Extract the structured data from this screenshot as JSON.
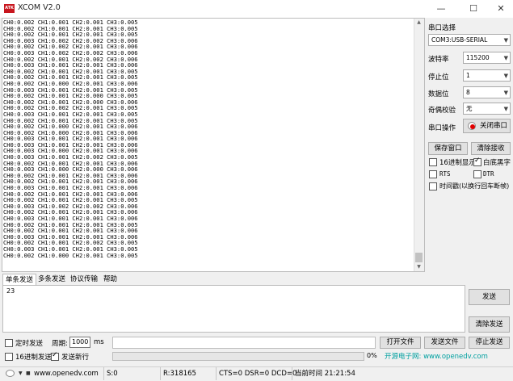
{
  "window": {
    "logo_text": "ATK",
    "title": "XCOM V2.0",
    "minimize": "—",
    "maximize": "☐",
    "close": "✕"
  },
  "receive": {
    "lines": [
      "CH0:0.002 CH1:0.001 CH2:0.001 CH3:0.005",
      "CH0:0.002 CH1:0.001 CH2:0.001 CH3:0.005",
      "CH0:0.002 CH1:0.001 CH2:0.001 CH3:0.005",
      "CH0:0.003 CH1:0.002 CH2:0.002 CH3:0.006",
      "CH0:0.002 CH1:0.002 CH2:0.001 CH3:0.006",
      "CH0:0.003 CH1:0.002 CH2:0.002 CH3:0.006",
      "CH0:0.002 CH1:0.001 CH2:0.002 CH3:0.006",
      "CH0:0.003 CH1:0.001 CH2:0.001 CH3:0.006",
      "CH0:0.002 CH1:0.001 CH2:0.001 CH3:0.005",
      "CH0:0.002 CH1:0.001 CH2:0.001 CH3:0.005",
      "CH0:0.002 CH1:0.000 CH2:0.001 CH3:0.006",
      "CH0:0.003 CH1:0.001 CH2:0.001 CH3:0.005",
      "CH0:0.002 CH1:0.001 CH2:0.000 CH3:0.005",
      "CH0:0.002 CH1:0.001 CH2:0.000 CH3:0.006",
      "CH0:0.002 CH1:0.002 CH2:0.001 CH3:0.005",
      "CH0:0.003 CH1:0.001 CH2:0.001 CH3:0.005",
      "CH0:0.002 CH1:0.001 CH2:0.001 CH3:0.005",
      "CH0:0.002 CH1:0.000 CH2:0.001 CH3:0.006",
      "CH0:0.002 CH1:0.000 CH2:0.001 CH3:0.006",
      "CH0:0.003 CH1:0.001 CH2:0.001 CH3:0.006",
      "CH0:0.003 CH1:0.001 CH2:0.001 CH3:0.006",
      "CH0:0.003 CH1:0.000 CH2:0.001 CH3:0.006",
      "CH0:0.003 CH1:0.001 CH2:0.002 CH3:0.005",
      "CH0:0.002 CH1:0.001 CH2:0.001 CH3:0.006",
      "CH0:0.003 CH1:0.000 CH2:0.000 CH3:0.006",
      "CH0:0.002 CH1:0.001 CH2:0.001 CH3:0.006",
      "CH0:0.002 CH1:0.001 CH2:0.001 CH3:0.006",
      "CH0:0.003 CH1:0.001 CH2:0.001 CH3:0.006",
      "CH0:0.002 CH1:0.001 CH2:0.001 CH3:0.006",
      "CH0:0.002 CH1:0.001 CH2:0.001 CH3:0.005",
      "CH0:0.003 CH1:0.002 CH2:0.002 CH3:0.006",
      "CH0:0.002 CH1:0.001 CH2:0.001 CH3:0.006",
      "CH0:0.003 CH1:0.001 CH2:0.001 CH3:0.006",
      "CH0:0.002 CH1:0.001 CH2:0.001 CH3:0.005",
      "CH0:0.002 CH1:0.001 CH2:0.001 CH3:0.006",
      "CH0:0.003 CH1:0.001 CH2:0.001 CH3:0.006",
      "CH0:0.002 CH1:0.001 CH2:0.002 CH3:0.005",
      "CH0:0.003 CH1:0.001 CH2:0.001 CH3:0.005",
      "CH0:0.002 CH1:0.000 CH2:0.001 CH3:0.005"
    ]
  },
  "serial": {
    "port_label": "串口选择",
    "port_value": "COM3:USB-SERIAL",
    "baud_label": "波特率",
    "baud_value": "115200",
    "stop_label": "停止位",
    "stop_value": "1",
    "data_label": "数据位",
    "data_value": "8",
    "parity_label": "奇偶校验",
    "parity_value": "无",
    "op_label": "串口操作",
    "op_button": "关闭串口",
    "status_color": "#e00000"
  },
  "recv_options": {
    "save_button": "保存窗口",
    "clear_button": "清除接收",
    "hex_display": "16进制显示",
    "hex_display_checked": false,
    "white_bg": "白底黑字",
    "white_bg_checked": true,
    "rts": "RTS",
    "dtr": "DTR",
    "timestamp": "时间戳(以换行回车断帧)"
  },
  "tabs": [
    "单条发送",
    "多条发送",
    "协议传输",
    "帮助"
  ],
  "send": {
    "text": "23",
    "send_button": "发送",
    "clear_send_button": "清除发送",
    "timed_send": "定时发送",
    "period_label": "周期:",
    "period_value": "1000",
    "period_unit": "ms",
    "hex_send": "16进制发送",
    "newline_send": "发送新行",
    "newline_checked": true,
    "open_file": "打开文件",
    "send_file": "发送文件",
    "stop_send": "停止发送",
    "progress": "0%",
    "promo": "开源电子网: www.openedv.com"
  },
  "status_bar": {
    "url": "www.openedv.com",
    "sent": "S:0",
    "received": "R:318165",
    "lines": "CTS=0 DSR=0 DCD=0",
    "time": "当前时间 21:21:54"
  }
}
